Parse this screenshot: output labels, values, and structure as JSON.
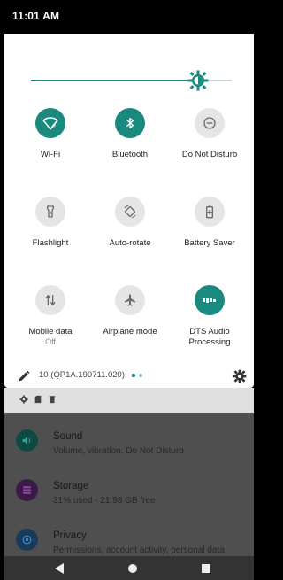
{
  "status_bar": {
    "time": "11:01 AM"
  },
  "brightness": {
    "level_percent": 83
  },
  "tiles": [
    {
      "label": "Wi-Fi",
      "sub": "",
      "state": "on",
      "icon": "wifi-icon"
    },
    {
      "label": "Bluetooth",
      "sub": "",
      "state": "on",
      "icon": "bluetooth-icon"
    },
    {
      "label": "Do Not Disturb",
      "sub": "",
      "state": "off",
      "icon": "do-not-disturb-icon"
    },
    {
      "label": "Flashlight",
      "sub": "",
      "state": "off",
      "icon": "flashlight-icon"
    },
    {
      "label": "Auto-rotate",
      "sub": "",
      "state": "off",
      "icon": "auto-rotate-icon"
    },
    {
      "label": "Battery Saver",
      "sub": "",
      "state": "off",
      "icon": "battery-saver-icon"
    },
    {
      "label": "Mobile data",
      "sub": "Off",
      "state": "off",
      "icon": "mobile-data-icon"
    },
    {
      "label": "Airplane mode",
      "sub": "",
      "state": "off",
      "icon": "airplane-icon"
    },
    {
      "label": "DTS Audio Processing",
      "sub": "",
      "state": "on",
      "icon": "dts-icon"
    }
  ],
  "footer": {
    "build": "10 (QP1A.190711.020)"
  },
  "settings_list": [
    {
      "title": "Sound",
      "subtitle": "Volume, vibration, Do Not Disturb",
      "icon": "sound-icon"
    },
    {
      "title": "Storage",
      "subtitle": "31% used - 21.98 GB free",
      "icon": "storage-icon"
    },
    {
      "title": "Privacy",
      "subtitle": "Permissions, account activity, personal data",
      "icon": "privacy-icon"
    }
  ],
  "colors": {
    "accent": "#1a8a7f",
    "tile_off": "#e5e5e5",
    "scrim": "#4f4f4f"
  }
}
